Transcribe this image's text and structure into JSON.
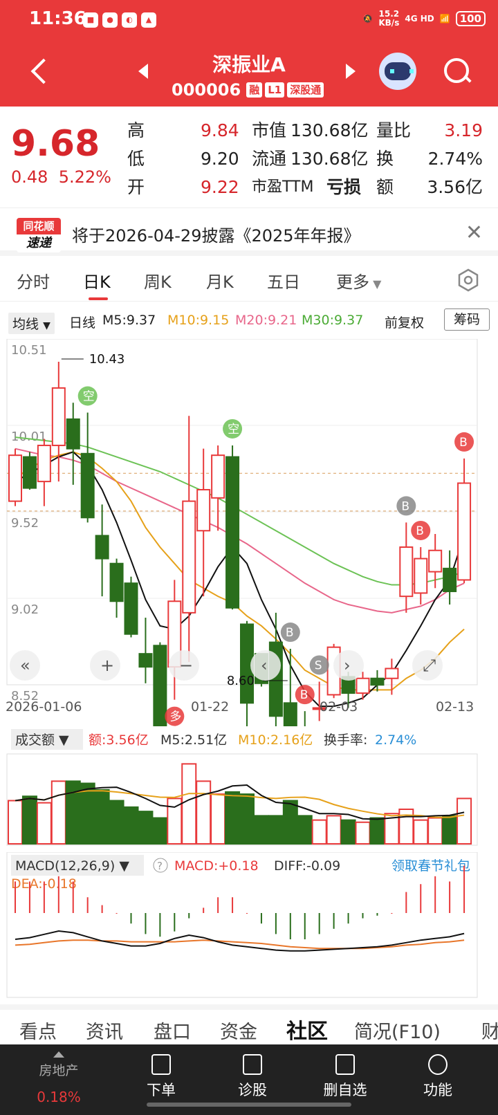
{
  "status": {
    "time": "11:36",
    "speed_top": "15.2",
    "speed_bot": "KB/s",
    "net": "4G HD",
    "battery": "100"
  },
  "header": {
    "name": "深振业A",
    "code": "000006",
    "tags": [
      "融",
      "L1",
      "深股通"
    ]
  },
  "quote": {
    "price": "9.68",
    "change": "0.48",
    "change_pct": "5.22%",
    "labels": {
      "high": "高",
      "low": "低",
      "open": "开",
      "mcap": "市值",
      "float": "流通",
      "pe": "市盈TTM",
      "vol_ratio": "量比",
      "turnover": "换",
      "amount": "额"
    },
    "high": "9.84",
    "low": "9.20",
    "open": "9.22",
    "mcap": "130.68亿",
    "float": "130.68亿",
    "pe": "亏损",
    "vol_ratio": "3.19",
    "turnover": "2.74%",
    "amount": "3.56亿"
  },
  "notice": {
    "logo_top": "同花顺",
    "logo_bottom": "速递",
    "text": "将于2026-04-29披露《2025年年报》"
  },
  "tabs": [
    "分时",
    "日K",
    "周K",
    "月K",
    "五日",
    "更多"
  ],
  "ma_bar": {
    "selector": "均线",
    "period": "日线",
    "m5": "M5:9.37",
    "m10": "M10:9.15",
    "m20": "M20:9.21",
    "m30": "M30:9.37",
    "adjust": "前复权",
    "chip": "筹码"
  },
  "chart_data": {
    "type": "candlestick",
    "y_ticks": [
      "10.51",
      "10.01",
      "9.52",
      "9.02",
      "8.52"
    ],
    "ylim": [
      8.52,
      10.51
    ],
    "x_ticks": [
      "2026-01-06",
      "01-22",
      "02-03",
      "02-13"
    ],
    "max_label": "10.43",
    "min_label": "8.60",
    "colors": {
      "up": "#e8393a",
      "down": "#2a6e1c",
      "m5": "#111111",
      "m10": "#e6a11a",
      "m20": "#e8668a",
      "m30": "#6cc255"
    },
    "candles": [
      {
        "o": 9.58,
        "c": 9.86,
        "h": 9.9,
        "l": 9.55
      },
      {
        "o": 9.85,
        "c": 9.66,
        "h": 9.88,
        "l": 9.65
      },
      {
        "o": 9.7,
        "c": 9.92,
        "h": 9.96,
        "l": 9.55
      },
      {
        "o": 9.92,
        "c": 10.27,
        "h": 10.43,
        "l": 9.7
      },
      {
        "o": 10.08,
        "c": 9.9,
        "h": 10.18,
        "l": 9.68
      },
      {
        "o": 9.87,
        "c": 9.48,
        "h": 10.12,
        "l": 9.45
      },
      {
        "o": 9.37,
        "c": 9.23,
        "h": 9.56,
        "l": 9.0
      },
      {
        "o": 9.2,
        "c": 8.97,
        "h": 9.23,
        "l": 8.87
      },
      {
        "o": 9.08,
        "c": 8.77,
        "h": 9.12,
        "l": 8.75
      },
      {
        "o": 8.65,
        "c": 8.57,
        "h": 8.87,
        "l": 8.47
      },
      {
        "o": 8.7,
        "c": 8.17,
        "h": 8.72,
        "l": 8.15
      },
      {
        "o": 8.57,
        "c": 8.97,
        "h": 9.1,
        "l": 8.37
      },
      {
        "o": 8.9,
        "c": 9.58,
        "h": 10.1,
        "l": 8.6
      },
      {
        "o": 9.4,
        "c": 9.65,
        "h": 9.9,
        "l": 9.0
      },
      {
        "o": 9.6,
        "c": 9.86,
        "h": 9.92,
        "l": 9.4
      },
      {
        "o": 9.85,
        "c": 8.93,
        "h": 9.92,
        "l": 8.92
      },
      {
        "o": 8.83,
        "c": 8.35,
        "h": 8.85,
        "l": 7.98
      },
      {
        "o": 8.65,
        "c": 8.47,
        "h": 8.62,
        "l": 8.45
      },
      {
        "o": 8.72,
        "c": 8.27,
        "h": 8.9,
        "l": 8.2
      },
      {
        "o": 8.35,
        "c": 8.05,
        "h": 8.68,
        "l": 7.88
      },
      {
        "o": 8.0,
        "c": 7.93,
        "h": 8.3,
        "l": 7.8
      },
      {
        "o": 8.32,
        "c": 8.32,
        "h": 8.48,
        "l": 8.24
      },
      {
        "o": 8.4,
        "c": 8.69,
        "h": 8.71,
        "l": 8.38
      },
      {
        "o": 8.51,
        "c": 8.41,
        "h": 8.54,
        "l": 8.32
      },
      {
        "o": 8.41,
        "c": 8.5,
        "h": 8.54,
        "l": 8.37
      },
      {
        "o": 8.5,
        "c": 8.46,
        "h": 8.55,
        "l": 8.42
      },
      {
        "o": 8.5,
        "c": 8.56,
        "h": 8.62,
        "l": 8.4
      },
      {
        "o": 9.0,
        "c": 9.3,
        "h": 9.45,
        "l": 8.9
      },
      {
        "o": 9.02,
        "c": 9.23,
        "h": 9.3,
        "l": 8.95
      },
      {
        "o": 9.15,
        "c": 9.28,
        "h": 9.38,
        "l": 9.05
      },
      {
        "o": 9.17,
        "c": 9.03,
        "h": 9.28,
        "l": 8.95
      },
      {
        "o": 9.1,
        "c": 9.69,
        "h": 9.84,
        "l": 9.08
      }
    ],
    "ma": {
      "m5": [
        9.7,
        9.75,
        9.8,
        9.85,
        9.88,
        9.8,
        9.65,
        9.45,
        9.22,
        8.98,
        8.82,
        8.8,
        8.88,
        9.02,
        9.18,
        9.3,
        9.2,
        8.98,
        8.8,
        8.58,
        8.42,
        8.33,
        8.33,
        8.35,
        8.38,
        8.46,
        8.53,
        8.67,
        8.82,
        8.98,
        9.1,
        9.37
      ],
      "m10": [
        9.72,
        9.78,
        9.83,
        9.86,
        9.88,
        9.85,
        9.78,
        9.7,
        9.58,
        9.42,
        9.3,
        9.2,
        9.1,
        9.05,
        9.0,
        8.96,
        8.88,
        8.82,
        8.74,
        8.65,
        8.55,
        8.5,
        8.45,
        8.43,
        8.43,
        8.43,
        8.43,
        8.5,
        8.55,
        8.62,
        8.72,
        8.8
      ],
      "m20": [
        9.9,
        9.88,
        9.86,
        9.85,
        9.83,
        9.8,
        9.75,
        9.7,
        9.66,
        9.62,
        9.58,
        9.54,
        9.5,
        9.46,
        9.42,
        9.37,
        9.32,
        9.26,
        9.2,
        9.14,
        9.08,
        9.03,
        8.98,
        8.95,
        8.93,
        8.91,
        8.9,
        8.92,
        8.94,
        8.98,
        9.04,
        9.08
      ],
      "m30": [
        9.97,
        9.96,
        9.95,
        9.94,
        9.93,
        9.91,
        9.88,
        9.85,
        9.82,
        9.79,
        9.76,
        9.72,
        9.68,
        9.64,
        9.6,
        9.55,
        9.5,
        9.45,
        9.4,
        9.35,
        9.3,
        9.25,
        9.2,
        9.16,
        9.12,
        9.09,
        9.07,
        9.07,
        9.08,
        9.1,
        9.12,
        9.15
      ]
    },
    "signals": [
      {
        "i": 5,
        "t": "空",
        "pos": "above",
        "c": "#6cc255"
      },
      {
        "i": 15,
        "t": "空",
        "pos": "above",
        "c": "#6cc255"
      },
      {
        "i": 11,
        "t": "多",
        "pos": "below",
        "c": "#e8393a"
      },
      {
        "i": 19,
        "t": "B",
        "pos": "above",
        "c": "#888888"
      },
      {
        "i": 20,
        "t": "B",
        "pos": "above",
        "c": "#e8393a"
      },
      {
        "i": 21,
        "t": "S",
        "pos": "above",
        "c": "#888888"
      },
      {
        "i": 27,
        "t": "B",
        "pos": "above",
        "c": "#888888"
      },
      {
        "i": 28,
        "t": "B",
        "pos": "above",
        "c": "#e8393a"
      },
      {
        "i": 31,
        "t": "B",
        "pos": "above",
        "c": "#e8393a"
      }
    ],
    "volume": {
      "selector": "成交额",
      "amount": "额:3.56亿",
      "m5": "M5:2.51亿",
      "m10": "M10:2.16亿",
      "turnover_label": "换手率:",
      "turnover": "2.74%",
      "values": [
        2.0,
        2.2,
        1.9,
        2.9,
        2.9,
        2.8,
        2.5,
        2.0,
        1.7,
        1.5,
        1.2,
        2.1,
        3.7,
        2.9,
        2.3,
        2.4,
        2.3,
        1.3,
        1.3,
        2.0,
        1.3,
        1.1,
        1.3,
        1.1,
        1.0,
        1.2,
        1.4,
        1.6,
        1.1,
        1.2,
        1.3,
        2.1
      ],
      "max": 4.0
    },
    "macd": {
      "selector": "MACD(12,26,9)",
      "macd": "MACD:+0.18",
      "diff": "DIFF:-0.09",
      "dea": "DEA:-0.18",
      "promo": "领取春节礼包",
      "hist": [
        0.12,
        0.12,
        0.12,
        0.14,
        0.12,
        0.06,
        0.03,
        0.0,
        -0.04,
        -0.08,
        -0.09,
        -0.07,
        -0.02,
        0.02,
        0.06,
        0.06,
        0.0,
        -0.04,
        -0.08,
        -0.1,
        -0.1,
        -0.08,
        -0.06,
        -0.04,
        -0.02,
        -0.01,
        0.0,
        0.08,
        0.11,
        0.14,
        0.12,
        0.18
      ],
      "diff_line": [
        -0.05,
        -0.03,
        0.01,
        0.05,
        0.03,
        -0.02,
        -0.07,
        -0.1,
        -0.13,
        -0.13,
        -0.1,
        -0.04,
        0.0,
        -0.03,
        -0.08,
        -0.12,
        -0.14,
        -0.16,
        -0.18,
        -0.19,
        -0.19,
        -0.18,
        -0.17,
        -0.16,
        -0.15,
        -0.14,
        -0.12,
        -0.09,
        -0.06,
        -0.04,
        -0.02,
        0.02
      ],
      "dea_line": [
        -0.12,
        -0.11,
        -0.09,
        -0.07,
        -0.06,
        -0.06,
        -0.07,
        -0.07,
        -0.08,
        -0.08,
        -0.08,
        -0.08,
        -0.07,
        -0.06,
        -0.07,
        -0.08,
        -0.09,
        -0.1,
        -0.12,
        -0.14,
        -0.15,
        -0.16,
        -0.16,
        -0.16,
        -0.16,
        -0.15,
        -0.14,
        -0.12,
        -0.11,
        -0.09,
        -0.08,
        -0.06
      ]
    }
  },
  "bottom_tabs": [
    "看点",
    "资讯",
    "盘口",
    "资金",
    "社区",
    "简况(F10)",
    "财"
  ],
  "bottom_bar": {
    "sector_name": "房地产",
    "sector_pct": "0.18%",
    "items": [
      "下单",
      "诊股",
      "删自选",
      "功能"
    ]
  }
}
